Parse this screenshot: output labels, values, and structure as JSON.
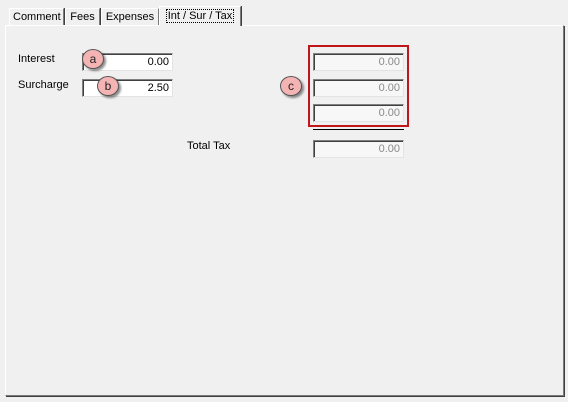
{
  "tabs": [
    {
      "label": "Comment",
      "active": false
    },
    {
      "label": "Fees",
      "active": false
    },
    {
      "label": "Expenses",
      "active": false
    },
    {
      "label": "Int / Sur / Tax",
      "active": true
    }
  ],
  "form": {
    "interest": {
      "label": "Interest",
      "value": "0.00"
    },
    "surcharge": {
      "label": "Surcharge",
      "value": "2.50"
    },
    "tax_fields": [
      "0.00",
      "0.00",
      "0.00"
    ],
    "total_tax": {
      "label": "Total Tax",
      "value": "0.00"
    }
  },
  "callouts": {
    "a": "a",
    "b": "b",
    "c": "c"
  },
  "colors": {
    "highlight_border": "#c0161b",
    "callout_fill": "#f5b4b4",
    "background": "#f0f0f0"
  }
}
